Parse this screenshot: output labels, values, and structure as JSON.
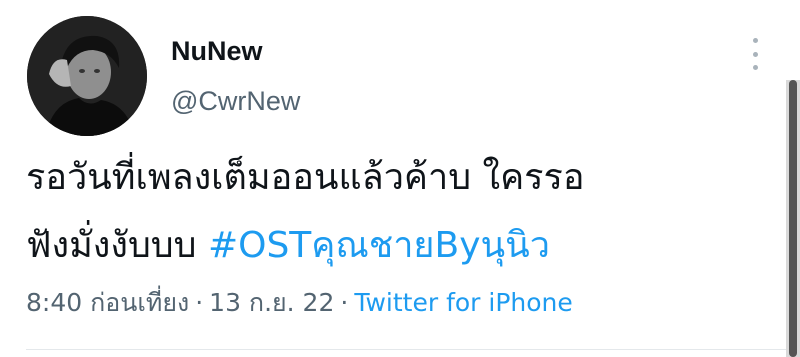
{
  "user": {
    "display_name": "NuNew",
    "handle": "@CwrNew"
  },
  "tweet": {
    "line1": "รอวันที่เพลงเต็มออนแล้วค้าบ ใครรอ",
    "line2_text": "ฟังมั่งงับบบ ",
    "hashtag": "#OSTคุณชายByนุนิว",
    "time": "8:40 ก่อนเที่ยง",
    "separator1": "·",
    "date": "13 ก.ย. 22",
    "separator2": "·",
    "source": "Twitter for iPhone"
  },
  "icons": {
    "avatar": "profile-photo",
    "more": "more-vertical-icon"
  },
  "colors": {
    "primary_text": "#0f1419",
    "secondary_text": "#536471",
    "link": "#1d9bf0"
  }
}
